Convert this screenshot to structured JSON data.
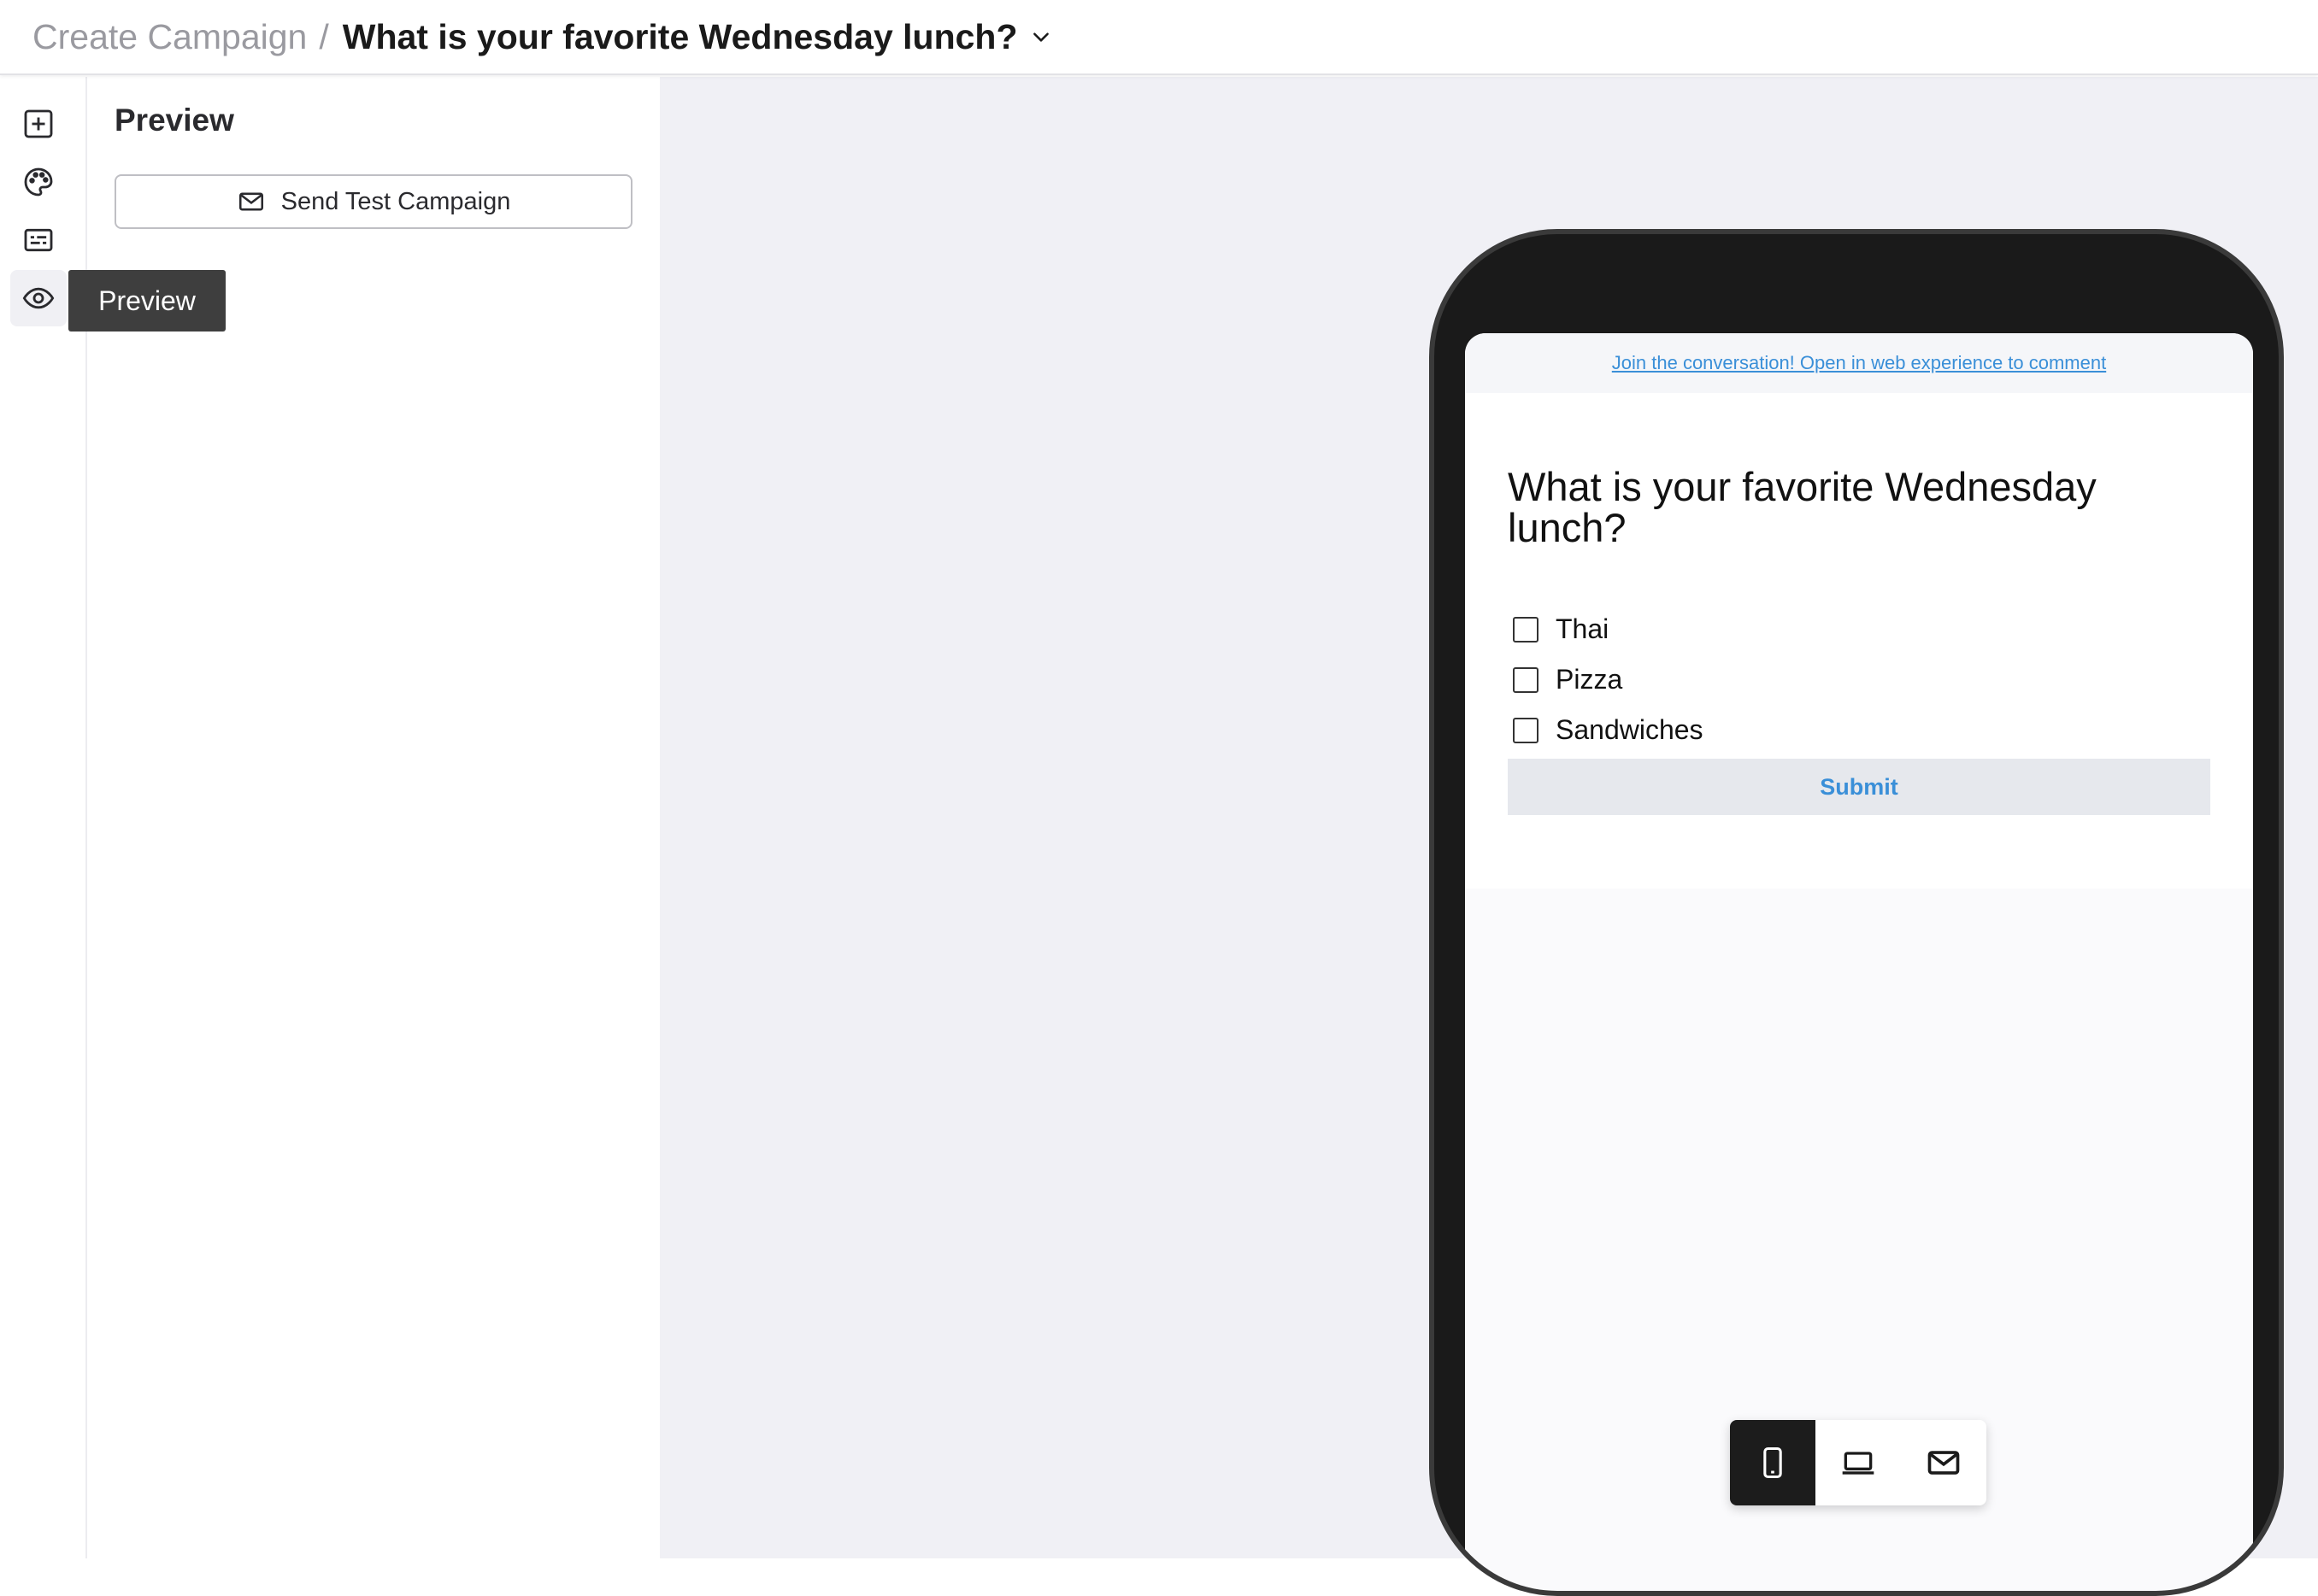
{
  "header": {
    "breadcrumb_parent": "Create Campaign",
    "separator": "/",
    "title": "What is your favorite Wednesday lunch?",
    "dropdown_icon": "chevron-down-icon"
  },
  "rail": {
    "items": [
      {
        "icon": "plus-square-icon",
        "active": false
      },
      {
        "icon": "palette-icon",
        "active": false
      },
      {
        "icon": "form-icon",
        "active": false
      },
      {
        "icon": "eye-icon",
        "active": true
      }
    ],
    "tooltip": "Preview"
  },
  "panel": {
    "title": "Preview",
    "send_test_label": "Send Test Campaign",
    "send_test_icon": "mail-icon"
  },
  "preview": {
    "banner_link": "Join the conversation! Open in web experience to comment",
    "question": "What is your favorite Wednesday lunch?",
    "options": [
      "Thai",
      "Pizza",
      "Sandwiches"
    ],
    "submit_label": "Submit",
    "link_color": "#3a8fd8"
  },
  "device_toggle": {
    "items": [
      {
        "icon": "phone-icon",
        "active": true
      },
      {
        "icon": "laptop-icon",
        "active": false
      },
      {
        "icon": "mail-icon",
        "active": false
      }
    ]
  }
}
